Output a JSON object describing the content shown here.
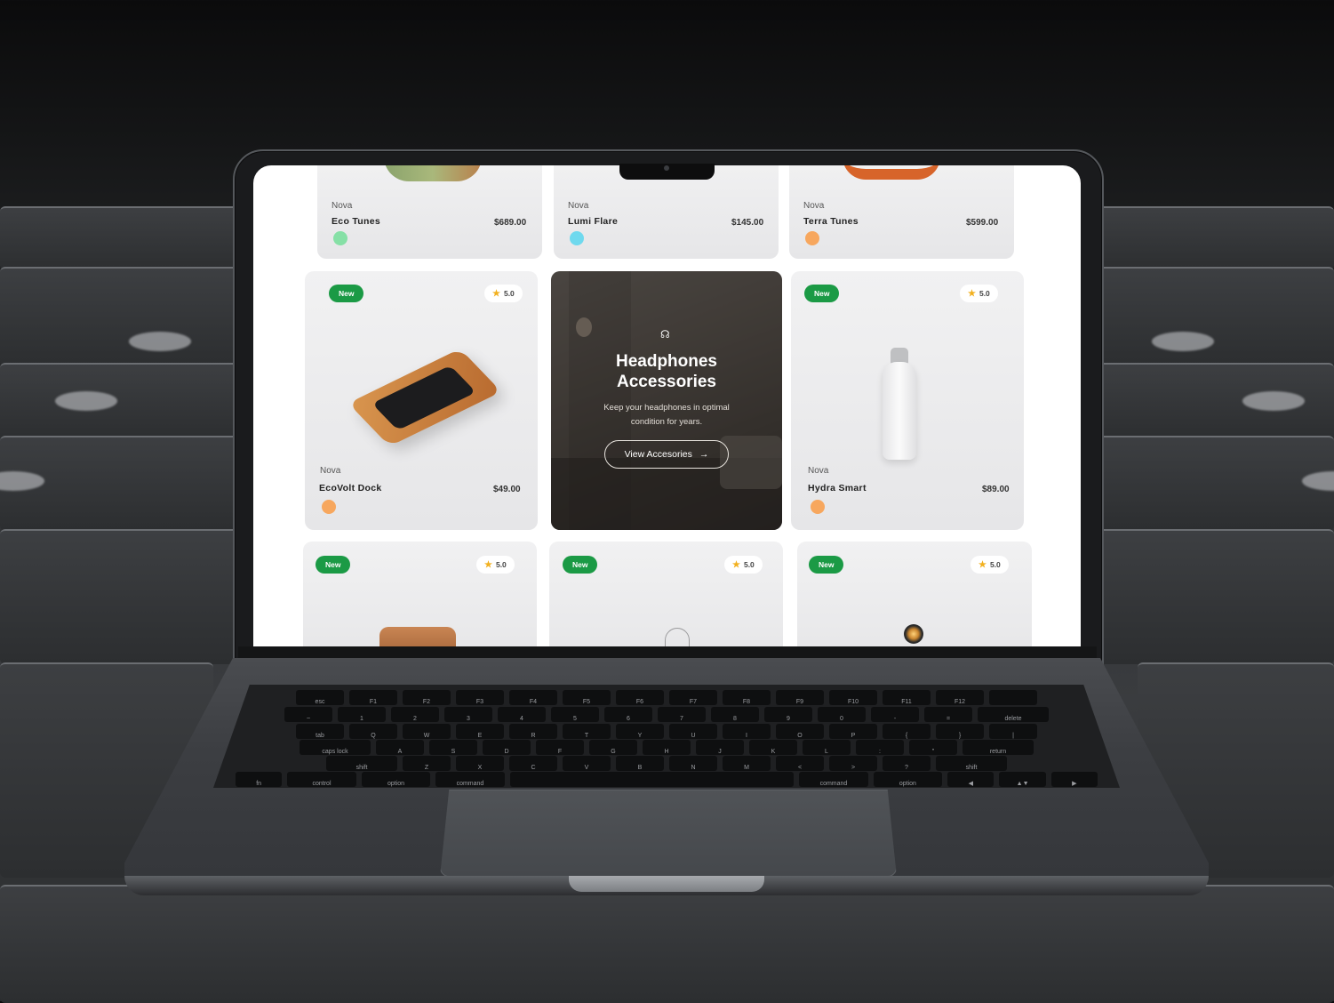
{
  "products_top": [
    {
      "brand": "Nova",
      "name": "Eco Tunes",
      "price": "$689.00",
      "swatch": "#86e0a6"
    },
    {
      "brand": "Nova",
      "name": "Lumi Flare",
      "price": "$145.00",
      "swatch": "#6fd9ee"
    },
    {
      "brand": "Nova",
      "name": "Terra Tunes",
      "price": "$599.00",
      "swatch": "#f7a75e"
    }
  ],
  "products_middle": [
    {
      "badge": "New",
      "rating": "5.0",
      "brand": "Nova",
      "name": "EcoVolt Dock",
      "price": "$49.00",
      "swatch": "#f7a75e"
    },
    {
      "badge": "New",
      "rating": "5.0",
      "brand": "Nova",
      "name": "Hydra Smart",
      "price": "$89.00",
      "swatch": "#f7a75e"
    }
  ],
  "promo": {
    "title_line1": "Headphones",
    "title_line2": "Accessories",
    "subtitle_line1": "Keep your headphones in optimal",
    "subtitle_line2": "condition for years.",
    "button_label": "View Accesories",
    "icon": "headphones-icon"
  },
  "products_bottom": [
    {
      "badge": "New",
      "rating": "5.0"
    },
    {
      "badge": "New",
      "rating": "5.0"
    },
    {
      "badge": "New",
      "rating": "5.0"
    }
  ],
  "keyboard": {
    "row1": [
      "esc",
      "F1",
      "F2",
      "F3",
      "F4",
      "F5",
      "F6",
      "F7",
      "F8",
      "F9",
      "F10",
      "F11",
      "F12",
      ""
    ],
    "row2": [
      "~",
      "1",
      "2",
      "3",
      "4",
      "5",
      "6",
      "7",
      "8",
      "9",
      "0",
      "-",
      "=",
      "delete"
    ],
    "row3": [
      "tab",
      "Q",
      "W",
      "E",
      "R",
      "T",
      "Y",
      "U",
      "I",
      "O",
      "P",
      "{",
      "}",
      "|"
    ],
    "row4": [
      "caps lock",
      "A",
      "S",
      "D",
      "F",
      "G",
      "H",
      "J",
      "K",
      "L",
      ":",
      "\"",
      "return"
    ],
    "row5": [
      "shift",
      "Z",
      "X",
      "C",
      "V",
      "B",
      "N",
      "M",
      "<",
      ">",
      "?",
      "shift"
    ],
    "row6": [
      "fn",
      "control",
      "option",
      "command",
      "",
      "command",
      "option",
      "◀",
      "▲▼",
      "▶"
    ]
  },
  "colors": {
    "new_badge": "#1b9a45",
    "star": "#f2b01e"
  }
}
